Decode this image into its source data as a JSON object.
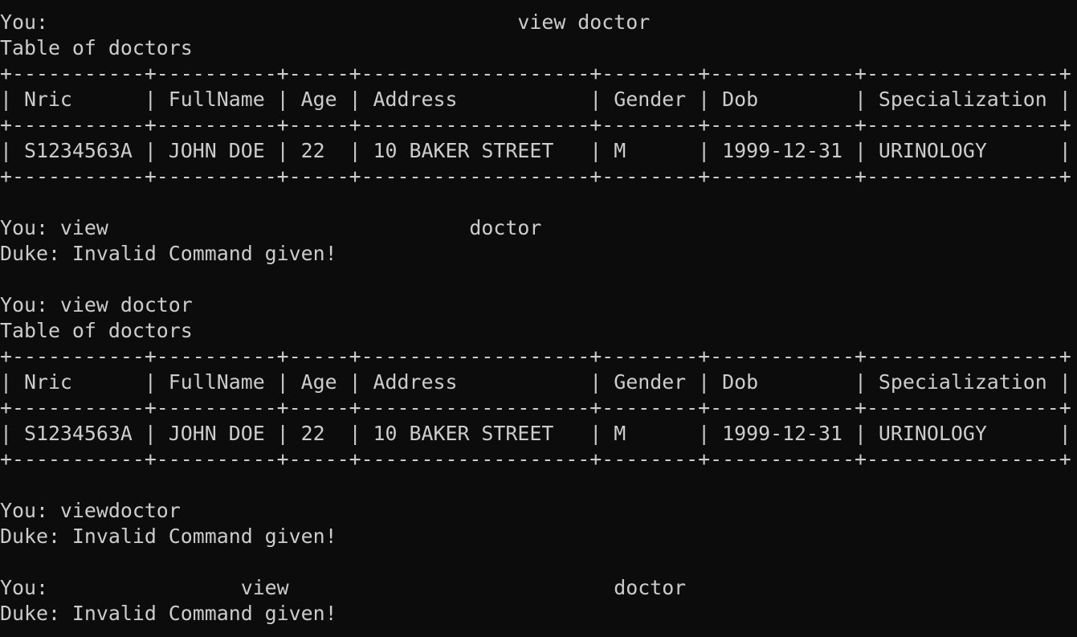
{
  "terminal": {
    "colors": {
      "background": "#0c0c0c",
      "foreground": "#cccccc"
    },
    "lines": [
      "You:                                       view doctor",
      "Table of doctors",
      "+-----------+----------+-----+-------------------+--------+------------+----------------+",
      "| Nric      | FullName | Age | Address           | Gender | Dob        | Specialization |",
      "+-----------+----------+-----+-------------------+--------+------------+----------------+",
      "| S1234563A | JOHN DOE | 22  | 10 BAKER STREET   | M      | 1999-12-31 | URINOLOGY      |",
      "+-----------+----------+-----+-------------------+--------+------------+----------------+",
      "",
      "You: view                              doctor",
      "Duke: Invalid Command given!",
      "",
      "You: view doctor",
      "Table of doctors",
      "+-----------+----------+-----+-------------------+--------+------------+----------------+",
      "| Nric      | FullName | Age | Address           | Gender | Dob        | Specialization |",
      "+-----------+----------+-----+-------------------+--------+------------+----------------+",
      "| S1234563A | JOHN DOE | 22  | 10 BAKER STREET   | M      | 1999-12-31 | URINOLOGY      |",
      "+-----------+----------+-----+-------------------+--------+------------+----------------+",
      "",
      "You: viewdoctor",
      "Duke: Invalid Command given!",
      "",
      "You:                view                           doctor",
      "Duke: Invalid Command given!"
    ]
  }
}
